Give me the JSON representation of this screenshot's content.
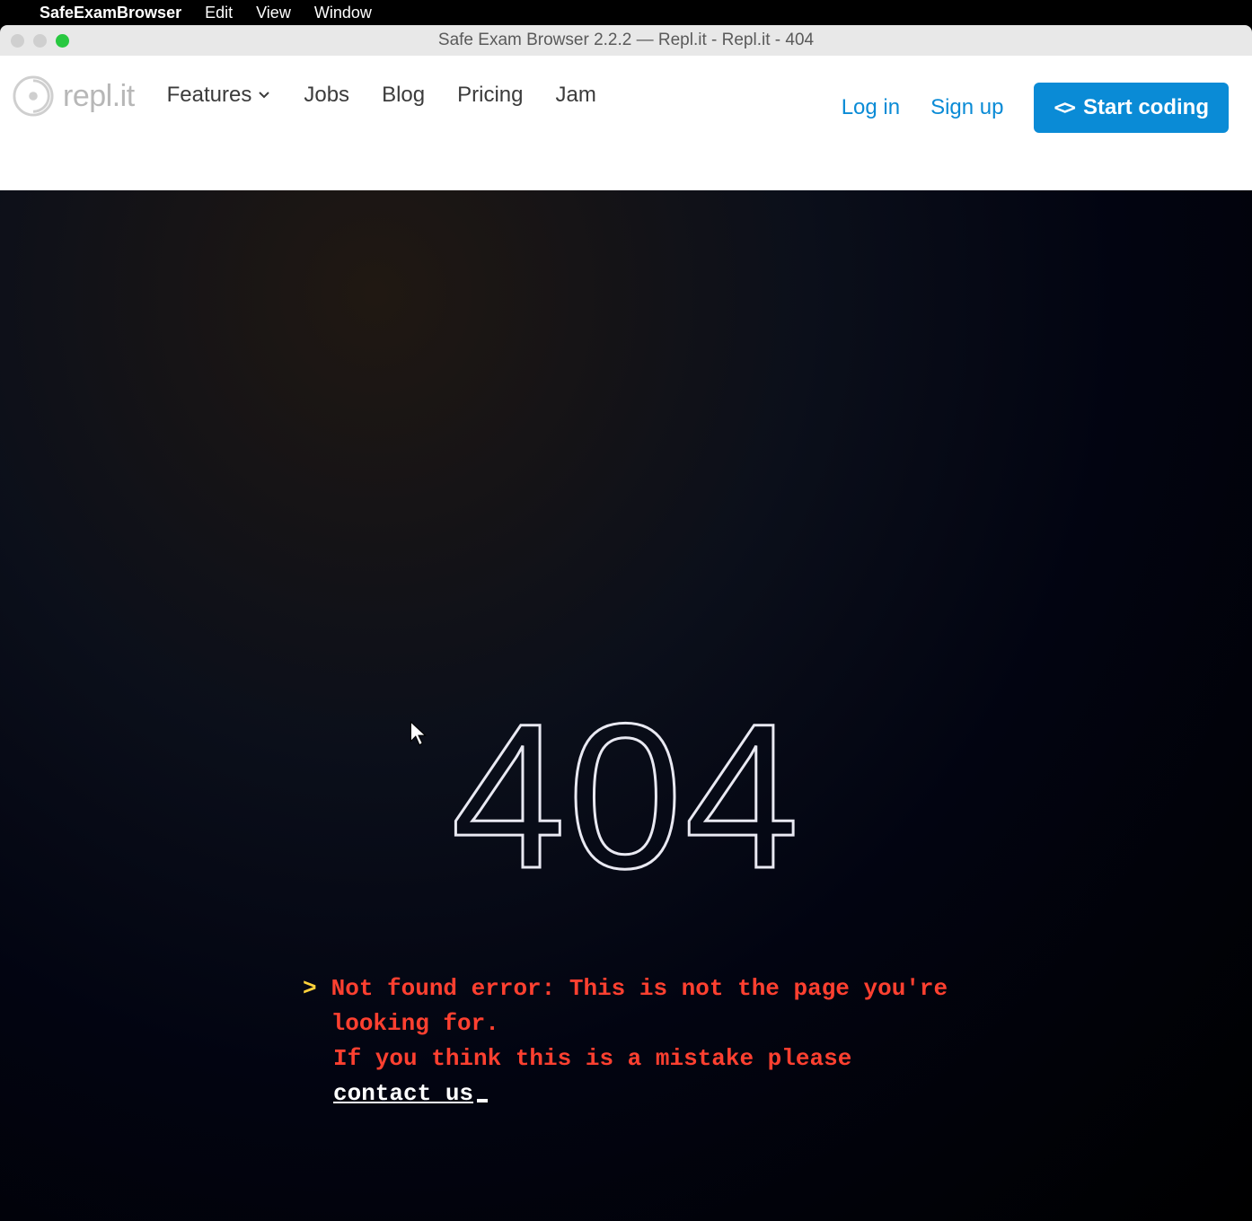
{
  "menubar": {
    "app_name": "SafeExamBrowser",
    "items": [
      "Edit",
      "View",
      "Window"
    ]
  },
  "window": {
    "title": "Safe Exam Browser 2.2.2  —  Repl.it - Repl.it - 404"
  },
  "header": {
    "brand": "repl.it",
    "nav": {
      "features": "Features",
      "jobs": "Jobs",
      "blog": "Blog",
      "pricing": "Pricing",
      "jam": "Jam"
    },
    "auth": {
      "login": "Log in",
      "signup": "Sign up",
      "cta": "Start coding"
    }
  },
  "page": {
    "code": "404",
    "error_prefix": "Not found error: ",
    "error_msg": "This is not the page you're looking for.",
    "mistake_msg": "If you think this is a mistake please ",
    "contact": "contact us",
    "prompt": ">"
  },
  "icons": {
    "apple": "apple-icon",
    "logo": "replit-logo-icon",
    "chevron": "chevron-down-icon",
    "code": "code-icon",
    "cursor": "cursor-icon"
  },
  "colors": {
    "accent": "#0a8bd6",
    "error": "#ff4030",
    "prompt": "#ffd23b",
    "bg_dark": "#020411"
  }
}
